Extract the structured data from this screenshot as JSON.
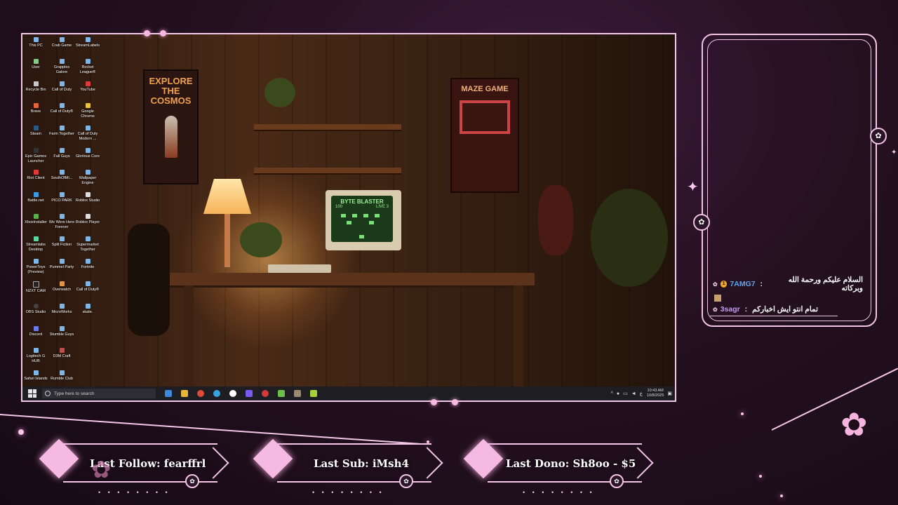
{
  "desktop": {
    "icons": [
      {
        "label": "This PC"
      },
      {
        "label": "Crab Game"
      },
      {
        "label": "StreamLabels"
      },
      {
        "label": "User"
      },
      {
        "label": "Grapples Galore"
      },
      {
        "label": "Rocket League®"
      },
      {
        "label": "Recycle Bin"
      },
      {
        "label": "Call of Duty"
      },
      {
        "label": "YouTube"
      },
      {
        "label": "Brave"
      },
      {
        "label": "Call of Duty®"
      },
      {
        "label": "Google Chrome"
      },
      {
        "label": "Steam"
      },
      {
        "label": "Farm Together"
      },
      {
        "label": "Call of Duty Modern ..."
      },
      {
        "label": "Epic Games Launcher"
      },
      {
        "label": "Fall Guys"
      },
      {
        "label": "Glorious Core"
      },
      {
        "label": "Riot Client"
      },
      {
        "label": "SouthOfMi..."
      },
      {
        "label": "Wallpaper Engine"
      },
      {
        "label": "Battle.net"
      },
      {
        "label": "PICO PARK"
      },
      {
        "label": "Roblox Studio"
      },
      {
        "label": "XboxInstaller"
      },
      {
        "label": "We Were Here Forever"
      },
      {
        "label": "Roblox Player"
      },
      {
        "label": "Streamlabs Desktop"
      },
      {
        "label": "Split Fiction"
      },
      {
        "label": "Supermarket Together"
      },
      {
        "label": "PowerToys (Preview)"
      },
      {
        "label": "Pummel Party"
      },
      {
        "label": "Fortnite"
      },
      {
        "label": "NZXT CAM"
      },
      {
        "label": "Overwatch"
      },
      {
        "label": "Call of Duty®"
      },
      {
        "label": "OBS Studio"
      },
      {
        "label": "MicroWorks"
      },
      {
        "label": "skate."
      },
      {
        "label": "Discord"
      },
      {
        "label": "Stumble Guys"
      },
      {
        "label": "Logitech G HUB"
      },
      {
        "label": "D3M Craft"
      },
      {
        "label": "Safari Islands"
      },
      {
        "label": "Rumble Club"
      }
    ]
  },
  "wallpaper": {
    "poster_left": "EXPLORE THE COSMOS",
    "poster_right": "MAZE GAME",
    "monitor_title": "BYTE BLASTER",
    "monitor_score": "100",
    "monitor_lives": "LIVE 3"
  },
  "taskbar": {
    "search_placeholder": "Type here to search",
    "apps": [
      "#3f87d8",
      "#e8b43a",
      "#e04a3a",
      "#3aa4e0",
      "#ffffff",
      "#7a5af0",
      "#d23a3a",
      "#6bbf4a",
      "#9a8a70",
      "#a6d23a"
    ],
    "time": "10:43 AM",
    "date": "10/8/2025",
    "lang": "ع"
  },
  "chat": {
    "messages": [
      {
        "user": "7AMG7",
        "sep": " : ",
        "text": "السلام عليكم ورحمة الله وبركاته",
        "badge": "1"
      },
      {
        "user": "3sagr",
        "sep": " : ",
        "text": "تمام انتو ايش اخباركم"
      }
    ]
  },
  "stats": {
    "last_follow": "Last Follow: fearffrl",
    "last_sub": "Last Sub: iMsh4",
    "last_dono": "Last Dono: Sh8oo - $5"
  },
  "colors": {
    "accent": "#f3c6e8",
    "diamond": "#f6b9e4",
    "background": "#24101f"
  }
}
